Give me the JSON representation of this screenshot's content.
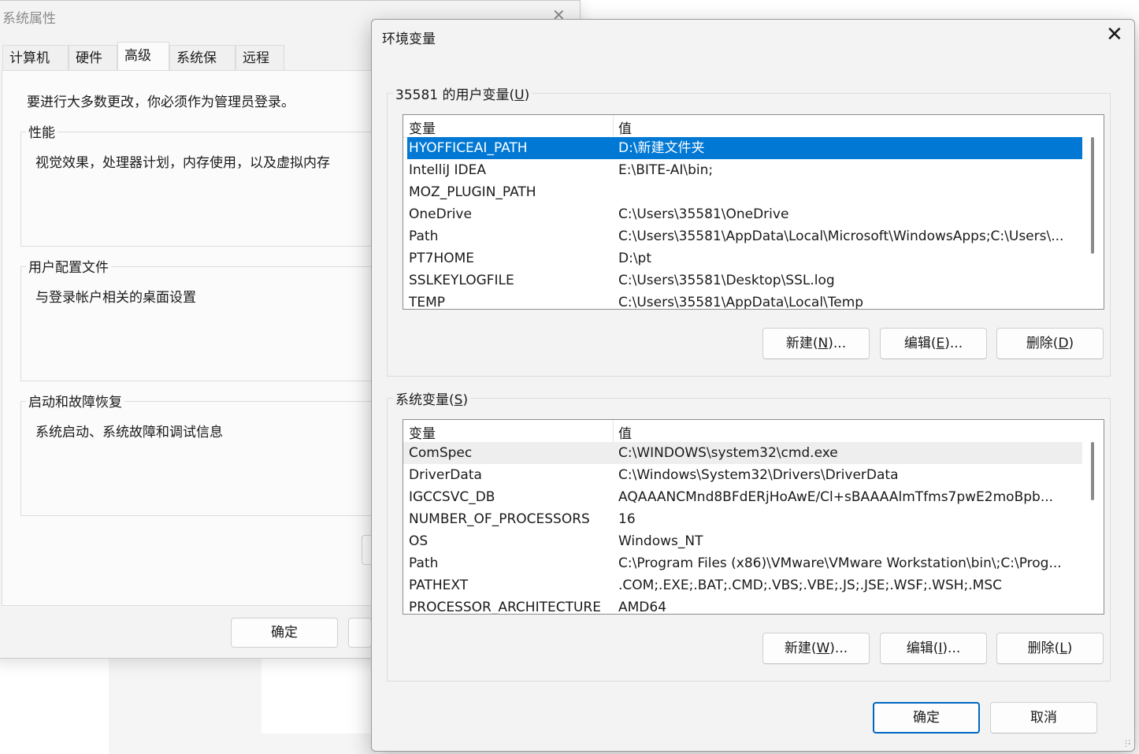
{
  "system_properties": {
    "title": "系统属性",
    "tabs": [
      {
        "label": "计算机名"
      },
      {
        "label": "硬件"
      },
      {
        "label": "高级"
      },
      {
        "label": "系统保护"
      },
      {
        "label": "远程"
      }
    ],
    "admin_note": "要进行大多数更改，你必须作为管理员登录。",
    "groups": [
      {
        "legend": "性能",
        "desc": "视觉效果，处理器计划，内存使用，以及虚拟内存"
      },
      {
        "legend": "用户配置文件",
        "desc": "与登录帐户相关的桌面设置"
      },
      {
        "legend": "启动和故障恢复",
        "desc": "系统启动、系统故障和调试信息"
      }
    ],
    "ok_label": "确定"
  },
  "env_dialog": {
    "title": "环境变量",
    "user_section": {
      "legend_prefix": "35581 的用户变量(",
      "legend_key": "U",
      "legend_suffix": ")",
      "col_variable": "变量",
      "col_value": "值",
      "rows": [
        {
          "name": "HYOFFICEAI_PATH",
          "value": "D:\\新建文件夹"
        },
        {
          "name": "IntelliJ IDEA",
          "value": "E:\\BITE-AI\\bin;"
        },
        {
          "name": "MOZ_PLUGIN_PATH",
          "value": ""
        },
        {
          "name": "OneDrive",
          "value": "C:\\Users\\35581\\OneDrive"
        },
        {
          "name": "Path",
          "value": "C:\\Users\\35581\\AppData\\Local\\Microsoft\\WindowsApps;C:\\Users\\..."
        },
        {
          "name": "PT7HOME",
          "value": "D:\\pt"
        },
        {
          "name": "SSLKEYLOGFILE",
          "value": "C:\\Users\\35581\\Desktop\\SSL.log"
        },
        {
          "name": "TEMP",
          "value": "C:\\Users\\35581\\AppData\\Local\\Temp"
        }
      ],
      "buttons": {
        "new": {
          "prefix": "新建(",
          "key": "N",
          "suffix": ")..."
        },
        "edit": {
          "prefix": "编辑(",
          "key": "E",
          "suffix": ")..."
        },
        "delete": {
          "prefix": "删除(",
          "key": "D",
          "suffix": ")"
        }
      }
    },
    "system_section": {
      "legend_prefix": "系统变量(",
      "legend_key": "S",
      "legend_suffix": ")",
      "col_variable": "变量",
      "col_value": "值",
      "rows": [
        {
          "name": "ComSpec",
          "value": "C:\\WINDOWS\\system32\\cmd.exe"
        },
        {
          "name": "DriverData",
          "value": "C:\\Windows\\System32\\Drivers\\DriverData"
        },
        {
          "name": "IGCCSVC_DB",
          "value": "AQAAANCMnd8BFdERjHoAwE/Cl+sBAAAAlmTfms7pwE2moBpb..."
        },
        {
          "name": "NUMBER_OF_PROCESSORS",
          "value": "16"
        },
        {
          "name": "OS",
          "value": "Windows_NT"
        },
        {
          "name": "Path",
          "value": "C:\\Program Files (x86)\\VMware\\VMware Workstation\\bin\\;C:\\Prog..."
        },
        {
          "name": "PATHEXT",
          "value": ".COM;.EXE;.BAT;.CMD;.VBS;.VBE;.JS;.JSE;.WSF;.WSH;.MSC"
        },
        {
          "name": "PROCESSOR_ARCHITECTURE",
          "value": "AMD64"
        }
      ],
      "buttons": {
        "new": {
          "prefix": "新建(",
          "key": "W",
          "suffix": ")..."
        },
        "edit": {
          "prefix": "编辑(",
          "key": "I",
          "suffix": ")..."
        },
        "delete": {
          "prefix": "删除(",
          "key": "L",
          "suffix": ")"
        }
      }
    },
    "ok_label": "确定",
    "cancel_label": "取消"
  },
  "colors": {
    "selection": "#0078d4",
    "accent_border": "#0067c0"
  }
}
